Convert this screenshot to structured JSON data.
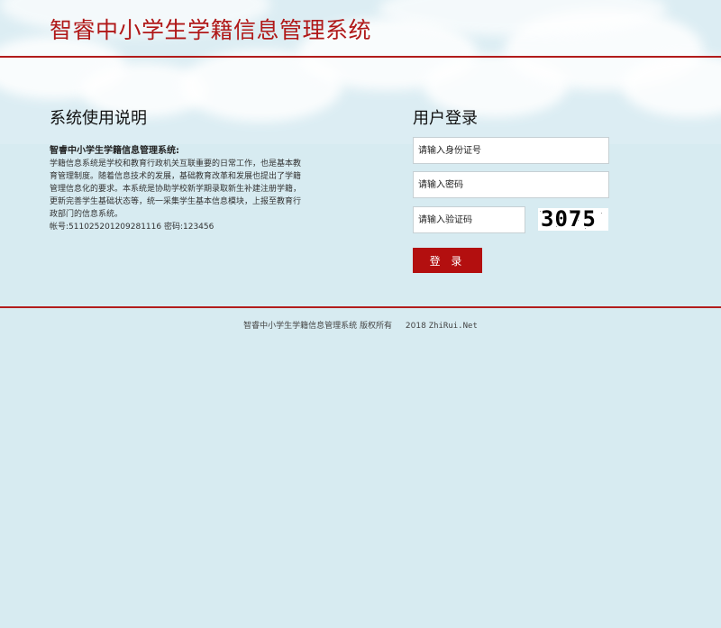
{
  "header": {
    "title": "智睿中小学生学籍信息管理系统"
  },
  "instructions": {
    "heading": "系统使用说明",
    "intro_title": "智睿中小学生学籍信息管理系统:",
    "intro_body": "学籍信息系统是学校和教育行政机关互联重要的日常工作，也是基本教育管理制度。随着信息技术的发展，基础教育改革和发展也提出了学籍管理信息化的要求。本系统是协助学校新学期录取新生补建注册学籍，更新完善学生基础状态等，统一采集学生基本信息模块，上报至教育行政部门的信息系统。",
    "account_line": "帐号:511025201209281116 密码:123456"
  },
  "login": {
    "heading": "用户登录",
    "id_placeholder": "请输入身份证号",
    "password_placeholder": "请输入密码",
    "captcha_placeholder": "请输入验证码",
    "captcha_code": "3075",
    "submit_label": "登 录"
  },
  "footer": {
    "copyright": "智睿中小学生学籍信息管理系统 版权所有",
    "year": "2018",
    "domain": "ZhiRui.Net"
  },
  "colors": {
    "brand_red": "#b01818",
    "background": "#d7ebf1"
  }
}
